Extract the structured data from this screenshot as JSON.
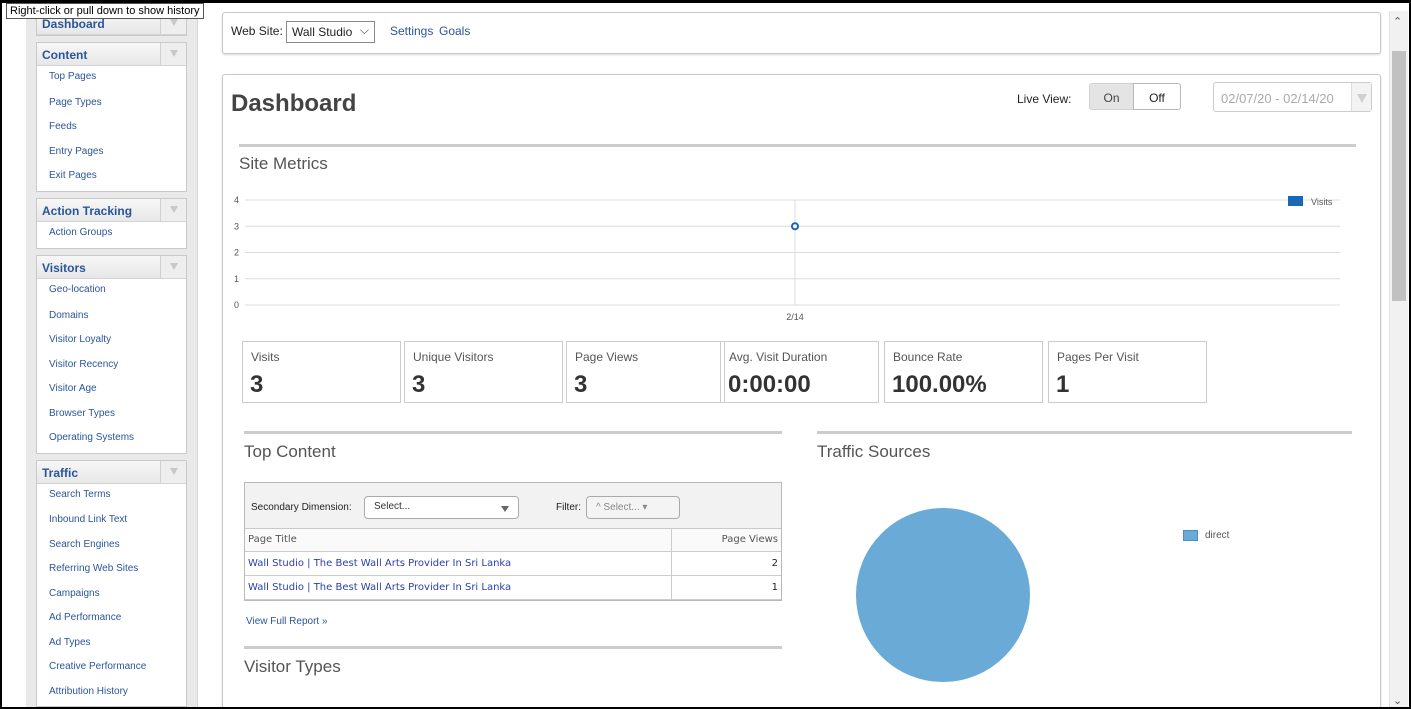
{
  "tooltip": "Right-click or pull down to show history",
  "sidebar": {
    "groups": [
      {
        "title": "Dashboard",
        "items": []
      },
      {
        "title": "Content",
        "items": [
          "Top Pages",
          "Page Types",
          "Feeds",
          "Entry Pages",
          "Exit Pages"
        ]
      },
      {
        "title": "Action Tracking",
        "items": [
          "Action Groups"
        ]
      },
      {
        "title": "Visitors",
        "items": [
          "Geo-location",
          "Domains",
          "Visitor Loyalty",
          "Visitor Recency",
          "Visitor Age",
          "Browser Types",
          "Operating Systems"
        ]
      },
      {
        "title": "Traffic",
        "items": [
          "Search Terms",
          "Inbound Link Text",
          "Search Engines",
          "Referring Web Sites",
          "Campaigns",
          "Ad Performance",
          "Ad Types",
          "Creative Performance",
          "Attribution History"
        ]
      }
    ]
  },
  "topbar": {
    "website_label": "Web Site:",
    "website_value": "Wall Studio",
    "settings_link": "Settings",
    "goals_link": "Goals"
  },
  "header": {
    "title": "Dashboard",
    "live_view_label": "Live View:",
    "live_on": "On",
    "live_off": "Off",
    "date_range": "02/07/20 - 02/14/20"
  },
  "site_metrics": {
    "title": "Site Metrics"
  },
  "chart_data": {
    "type": "line",
    "x": [
      "2/14"
    ],
    "series": [
      {
        "name": "Visits",
        "values": [
          3
        ],
        "color": "#1a66b7"
      }
    ],
    "ylim": [
      0,
      4
    ],
    "yticks": [
      0,
      1,
      2,
      3,
      4
    ],
    "xlabel": "",
    "ylabel": "",
    "grid": true,
    "legend": "top-right"
  },
  "metrics": [
    {
      "label": "Visits",
      "value": "3"
    },
    {
      "label": "Unique Visitors",
      "value": "3"
    },
    {
      "label": "Page Views",
      "value": "3"
    },
    {
      "label": "Avg. Visit Duration",
      "value": "0:00:00"
    },
    {
      "label": "Bounce Rate",
      "value": "100.00%"
    },
    {
      "label": "Pages Per Visit",
      "value": "1"
    }
  ],
  "top_content": {
    "title": "Top Content",
    "secondary_dimension_label": "Secondary Dimension:",
    "secondary_dimension_value": "Select...",
    "filter_label": "Filter:",
    "filter_value": "^ Select... ▾",
    "columns": [
      "Page Title",
      "Page Views"
    ],
    "rows": [
      {
        "page_title": "Wall Studio | The Best Wall Arts Provider In Sri Lanka",
        "views": "2"
      },
      {
        "page_title": "Wall Studio | The Best Wall Arts Provider In Sri Lanka",
        "views": "1"
      }
    ],
    "view_full_report": "View Full Report »"
  },
  "traffic_sources": {
    "title": "Traffic Sources",
    "legend": [
      {
        "label": "direct",
        "value": 1,
        "color": "#6aaad6"
      }
    ]
  },
  "visitor_types": {
    "title": "Visitor Types"
  }
}
